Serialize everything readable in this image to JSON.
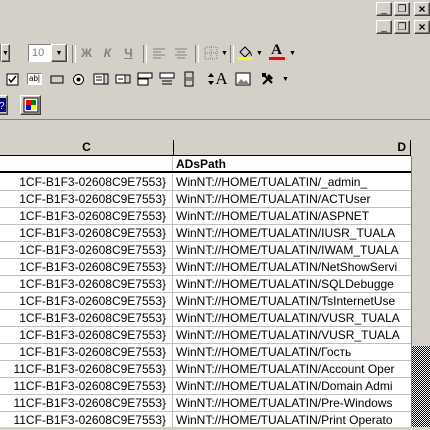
{
  "window_controls": {
    "minimize": "_",
    "restore": "❐",
    "close": "×"
  },
  "format_toolbar": {
    "font_size": "10",
    "bold": "Ж",
    "italic": "К",
    "underline": "Ч",
    "font_color_letter": "A"
  },
  "forms_toolbar": {
    "label_glyph": "A",
    "edit_box_glyph": "ab|"
  },
  "columns": {
    "c": "C",
    "d": "D"
  },
  "header_row": {
    "c": "",
    "d": "ADsPath"
  },
  "rows": [
    {
      "c": "1CF-B1F3-02608C9E7553}",
      "d": "WinNT://HOME/TUALATIN/_admin_"
    },
    {
      "c": "1CF-B1F3-02608C9E7553}",
      "d": "WinNT://HOME/TUALATIN/ACTUser"
    },
    {
      "c": "1CF-B1F3-02608C9E7553}",
      "d": "WinNT://HOME/TUALATIN/ASPNET"
    },
    {
      "c": "1CF-B1F3-02608C9E7553}",
      "d": "WinNT://HOME/TUALATIN/IUSR_TUALA"
    },
    {
      "c": "1CF-B1F3-02608C9E7553}",
      "d": "WinNT://HOME/TUALATIN/IWAM_TUALA"
    },
    {
      "c": "1CF-B1F3-02608C9E7553}",
      "d": "WinNT://HOME/TUALATIN/NetShowServi"
    },
    {
      "c": "1CF-B1F3-02608C9E7553}",
      "d": "WinNT://HOME/TUALATIN/SQLDebugge"
    },
    {
      "c": "1CF-B1F3-02608C9E7553}",
      "d": "WinNT://HOME/TUALATIN/TsInternetUse"
    },
    {
      "c": "1CF-B1F3-02608C9E7553}",
      "d": "WinNT://HOME/TUALATIN/VUSR_TUALA"
    },
    {
      "c": "1CF-B1F3-02608C9E7553}",
      "d": "WinNT://HOME/TUALATIN/VUSR_TUALA"
    },
    {
      "c": "1CF-B1F3-02608C9E7553}",
      "d": "WinNT://HOME/TUALATIN/Гость"
    },
    {
      "c": "11CF-B1F3-02608C9E7553}",
      "d": "WinNT://HOME/TUALATIN/Account Oper"
    },
    {
      "c": "11CF-B1F3-02608C9E7553}",
      "d": "WinNT://HOME/TUALATIN/Domain Admi"
    },
    {
      "c": "11CF-B1F3-02608C9E7553}",
      "d": "WinNT://HOME/TUALATIN/Pre-Windows"
    },
    {
      "c": "11CF-B1F3-02608C9E7553}",
      "d": "WinNT://HOME/TUALATIN/Print Operato"
    }
  ],
  "colors": {
    "font_color": "#ff0000",
    "fill_color": "#ffff00"
  }
}
